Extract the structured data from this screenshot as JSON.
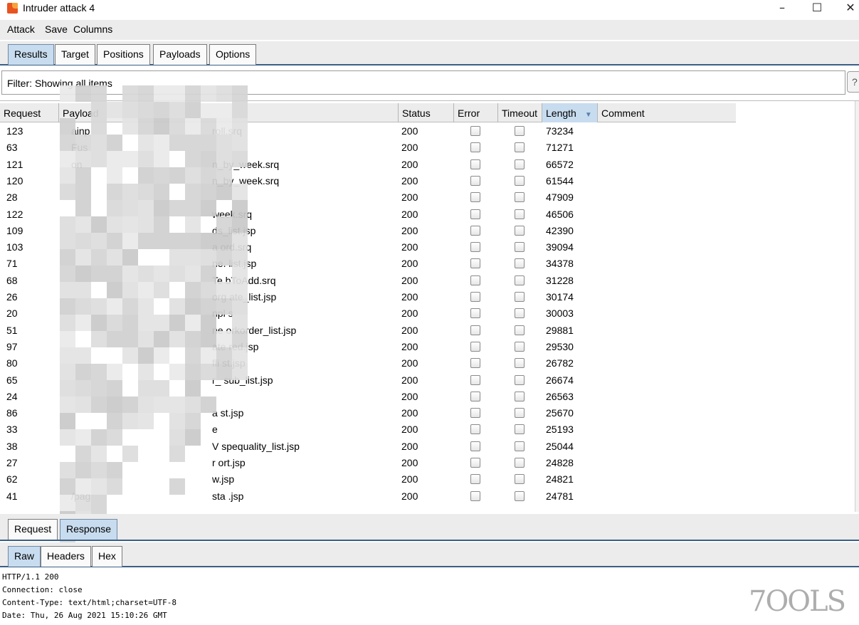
{
  "window": {
    "title": "Intruder attack 4",
    "minimize": "–",
    "maximize": "☐",
    "close": "✕"
  },
  "menu": [
    "Attack",
    "Save",
    "Columns"
  ],
  "tabs": [
    "Results",
    "Target",
    "Positions",
    "Payloads",
    "Options"
  ],
  "filter": {
    "text": "Filter: Showing all items",
    "help": "?"
  },
  "table": {
    "columns": [
      "Request",
      "Payload",
      "Status",
      "Error",
      "Timeout",
      "Length",
      "Comment"
    ],
    "sort_indicator": "▼",
    "rows": [
      {
        "request": "123",
        "payload": "ainp",
        "payload_tail": "roll.srq",
        "status": "200",
        "length": "73234"
      },
      {
        "request": "63",
        "payload": "Fus",
        "payload_tail": "",
        "status": "200",
        "length": "71271"
      },
      {
        "request": "121",
        "payload": "on",
        "payload_tail": "n_by_week.srq",
        "status": "200",
        "length": "66572"
      },
      {
        "request": "120",
        "payload": "",
        "payload_tail": "n_by_week.srq",
        "status": "200",
        "length": "61544"
      },
      {
        "request": "28",
        "payload": "",
        "payload_tail": "",
        "status": "200",
        "length": "47909"
      },
      {
        "request": "122",
        "payload": "",
        "payload_tail": "week.srq",
        "status": "200",
        "length": "46506"
      },
      {
        "request": "109",
        "payload": "",
        "payload_tail": "ds_list.jsp",
        "status": "200",
        "length": "42390"
      },
      {
        "request": "103",
        "payload": "",
        "payload_tail": "a    ord.srq",
        "status": "200",
        "length": "39094"
      },
      {
        "request": "71",
        "payload": "",
        "payload_tail": "ne.    list.jsp",
        "status": "200",
        "length": "34378"
      },
      {
        "request": "68",
        "payload": "",
        "payload_tail": "Te    bToAdd.srq",
        "status": "200",
        "length": "31228"
      },
      {
        "request": "26",
        "payload": "",
        "payload_tail": "org    ate_list.jsp",
        "status": "200",
        "length": "30174"
      },
      {
        "request": "20",
        "payload": "",
        "payload_tail": "npl    s",
        "status": "200",
        "length": "30003"
      },
      {
        "request": "51",
        "payload": "",
        "payload_tail": "ne    orkorder_list.jsp",
        "status": "200",
        "length": "29881"
      },
      {
        "request": "97",
        "payload": "",
        "payload_tail": "ate    red.jsp",
        "status": "200",
        "length": "29530"
      },
      {
        "request": "80",
        "payload": "",
        "payload_tail": "fli    st.jsp",
        "status": "200",
        "length": "26782"
      },
      {
        "request": "65",
        "payload": "",
        "payload_tail": "r_    sub_list.jsp",
        "status": "200",
        "length": "26674"
      },
      {
        "request": "24",
        "payload": "",
        "payload_tail": "",
        "status": "200",
        "length": "26563"
      },
      {
        "request": "86",
        "payload": "",
        "payload_tail": "a    st.jsp",
        "status": "200",
        "length": "25670"
      },
      {
        "request": "33",
        "payload": "",
        "payload_tail": "e",
        "status": "200",
        "length": "25193"
      },
      {
        "request": "38",
        "payload": "",
        "payload_tail": "V    spequality_list.jsp",
        "status": "200",
        "length": "25044"
      },
      {
        "request": "27",
        "payload": "",
        "payload_tail": "r    ort.jsp",
        "status": "200",
        "length": "24828"
      },
      {
        "request": "62",
        "payload": "",
        "payload_tail": "w.jsp",
        "status": "200",
        "length": "24821"
      },
      {
        "request": "41",
        "payload": "/pag",
        "payload_tail": "sta    .jsp",
        "status": "200",
        "length": "24781"
      }
    ]
  },
  "lower_tabs": [
    "Request",
    "Response"
  ],
  "view_tabs": [
    "Raw",
    "Headers",
    "Hex"
  ],
  "response_lines": [
    "HTTP/1.1 200",
    "Connection: close",
    "Content-Type: text/html;charset=UTF-8",
    "Date: Thu, 26 Aug 2021 15:10:26 GMT"
  ],
  "watermark": "7OOLS",
  "colors": {
    "accent": "#3b5f86",
    "active_tab": "#c8dcef"
  }
}
